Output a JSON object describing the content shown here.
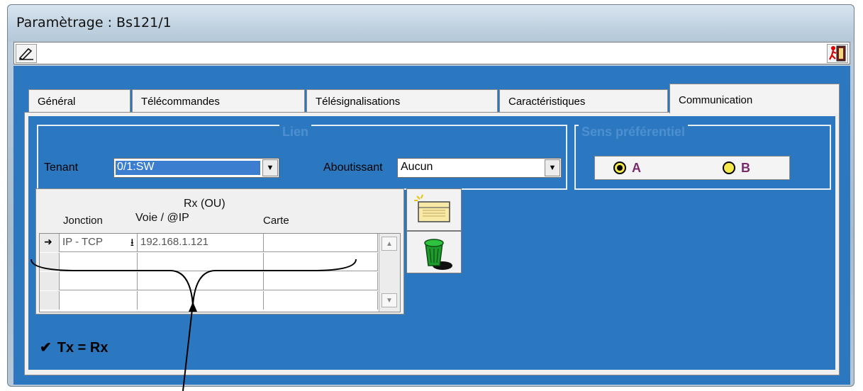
{
  "window": {
    "title": "Paramètrage : Bs121/1"
  },
  "toolbar": {
    "edit_icon": "pen-icon",
    "exit_icon": "exit-door-icon"
  },
  "tabs": [
    {
      "label": "Général"
    },
    {
      "label": "Télécommandes"
    },
    {
      "label": "Télésignalisations"
    },
    {
      "label": "Caractéristiques"
    },
    {
      "label": "Communication",
      "active": true
    }
  ],
  "lien": {
    "title": "Lien",
    "tenant_label": "Tenant",
    "tenant_value": "0/1:SW",
    "aboutissant_label": "Aboutissant",
    "aboutissant_value": "Aucun"
  },
  "sens": {
    "title": "Sens préférentiel",
    "option_a": "A",
    "option_b": "B",
    "selected": "A"
  },
  "grid": {
    "header_group": "Rx (OU)",
    "col_jonction": "Jonction",
    "col_voie": "Voie / @IP",
    "col_carte": "Carte",
    "row1": {
      "jonction": "IP - TCP",
      "voie": "192.168.1.121",
      "carte": ""
    }
  },
  "side_buttons": {
    "new_icon": "new-folder-icon",
    "delete_icon": "trash-icon"
  },
  "txrx": {
    "label": "Tx = Rx",
    "checked": true
  },
  "colors": {
    "panel_blue": "#2c78c0",
    "selection": "#3b7ed0",
    "radio_fill": "#f5e84a"
  }
}
